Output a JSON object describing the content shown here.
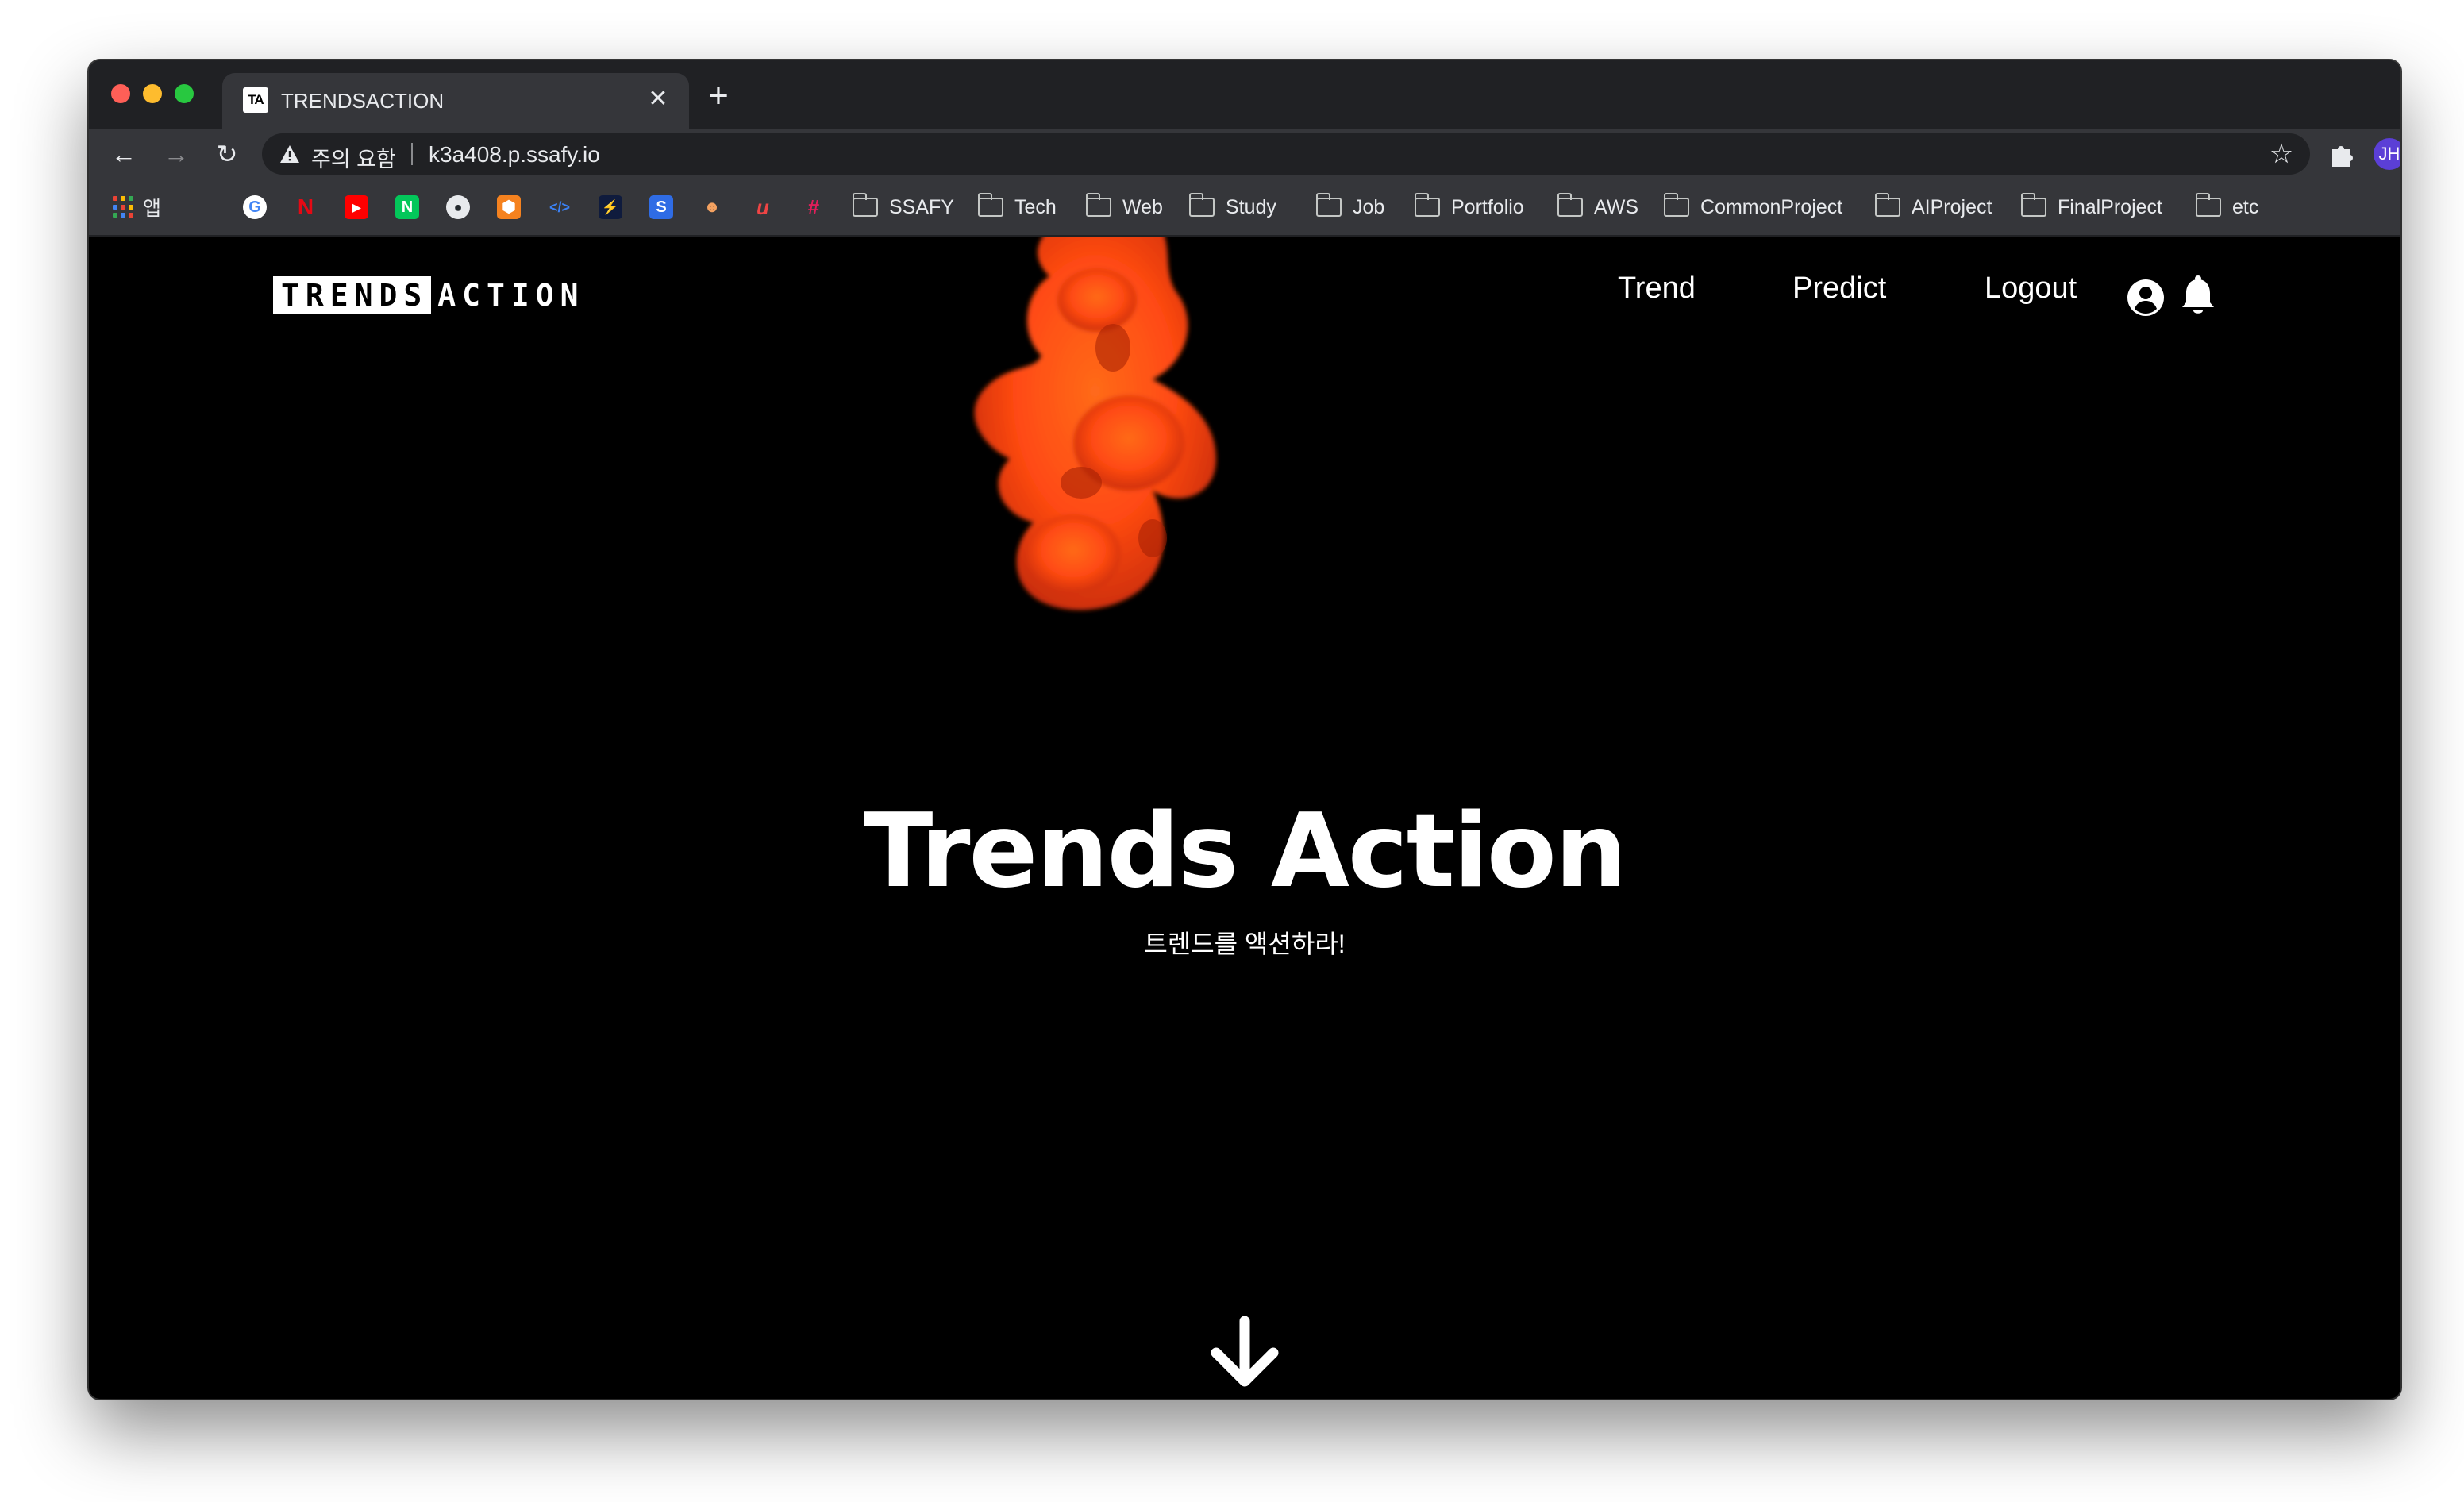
{
  "browser": {
    "tab": {
      "favicon_text": "TA",
      "title": "TRENDSACTION",
      "close_icon": "close-icon"
    },
    "new_tab_icon": "plus-icon",
    "toolbar": {
      "back_icon": "arrow-left-icon",
      "forward_icon": "arrow-right-icon",
      "reload_icon": "reload-icon",
      "security_label": "주의 요함",
      "url": "k3a408.p.ssafy.io",
      "bookmark_star_icon": "star-icon",
      "extensions_icon": "puzzle-icon",
      "profile_initials": "JH",
      "profile_color": "#5b3fd6",
      "menu_icon": "more-vert-icon"
    },
    "bookmarks": {
      "apps_label": "앱",
      "folders": [
        "SSAFY",
        "Tech",
        "Web",
        "Study",
        "Job",
        "Portfolio",
        "AWS",
        "CommonProject",
        "AIProject",
        "FinalProject",
        "etc"
      ]
    }
  },
  "page": {
    "logo": {
      "part1": "TRENDS",
      "part2": "ACTION"
    },
    "nav": {
      "trend": "Trend",
      "predict": "Predict",
      "logout": "Logout"
    },
    "hero": {
      "title": "Trends Action",
      "subtitle": "트렌드를 액션하라!"
    },
    "accent_color": "#ff4a12"
  }
}
